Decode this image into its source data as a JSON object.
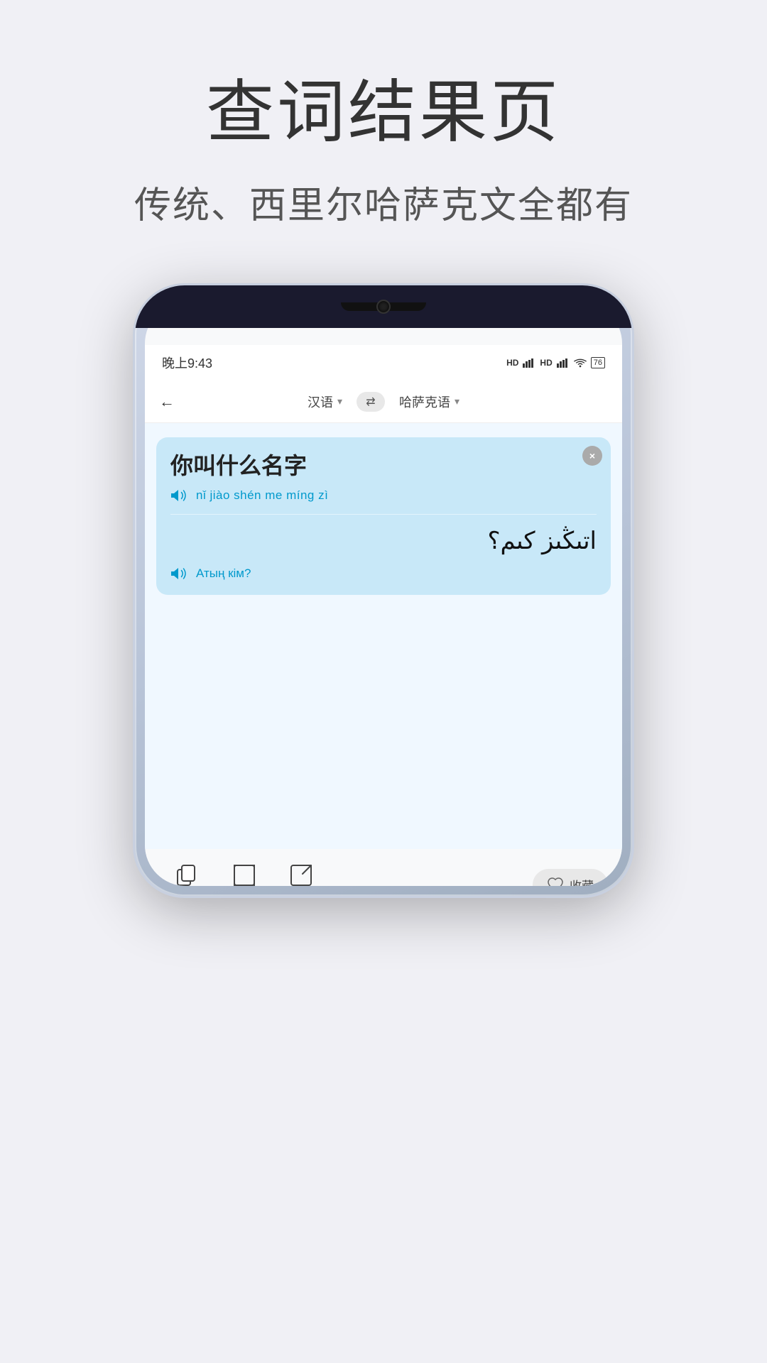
{
  "page": {
    "title": "查词结果页",
    "subtitle": "传统、西里尔哈萨克文全都有"
  },
  "status_bar": {
    "time": "晚上9:43",
    "hd1": "HD",
    "hd2": "HD",
    "battery": "76"
  },
  "nav": {
    "source_lang": "汉语",
    "target_lang": "哈萨克语",
    "switch_icon": "⇄"
  },
  "translation_card": {
    "source_text": "你叫什么名字",
    "pinyin": "nǐ jiào shén me míng zì",
    "arabic_script": "اتىڭىز كىم؟",
    "latin_script": "Атың кім?",
    "close_btn": "×"
  },
  "actions": {
    "copy": "复制",
    "fullscreen": "全屏",
    "share": "分享",
    "favorite": "收藏"
  }
}
